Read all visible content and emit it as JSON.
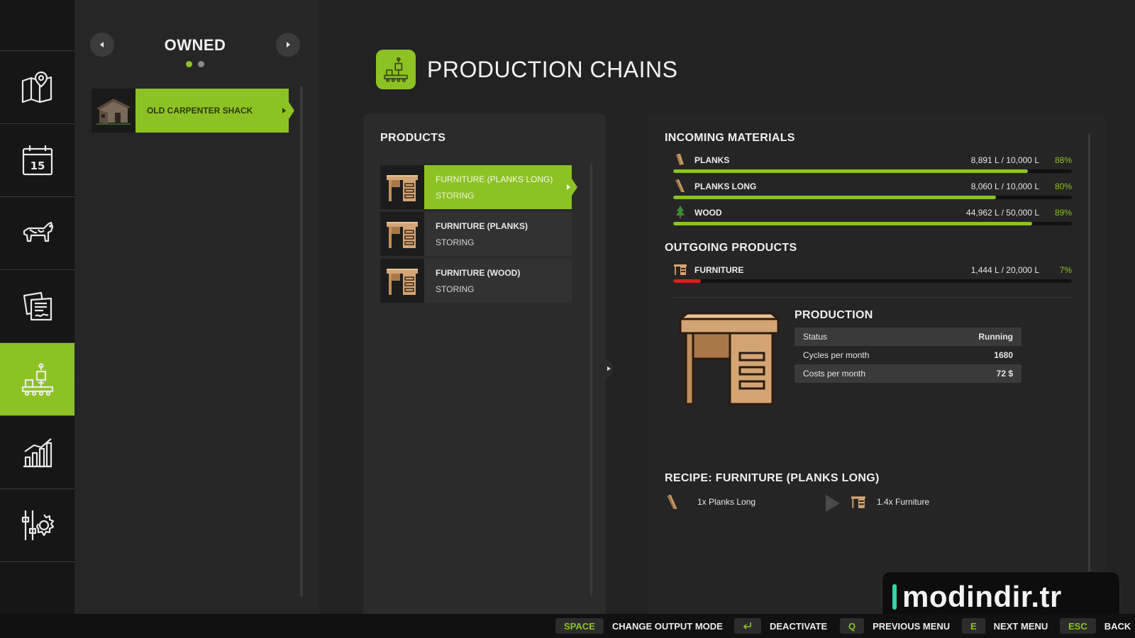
{
  "owned": {
    "title": "OWNED",
    "page_dots": 2,
    "active_dot": 1,
    "items": [
      {
        "label": "OLD CARPENTER SHACK",
        "icon": "shack-thumbnail",
        "selected": true
      }
    ]
  },
  "nav": {
    "items": [
      {
        "name": "map",
        "icon": "map-icon"
      },
      {
        "name": "calendar",
        "icon": "calendar-icon",
        "day": "15"
      },
      {
        "name": "animals",
        "icon": "cow-icon"
      },
      {
        "name": "contracts",
        "icon": "contracts-icon"
      },
      {
        "name": "production",
        "icon": "production-icon",
        "active": true
      },
      {
        "name": "statistics",
        "icon": "chart-icon"
      },
      {
        "name": "settings",
        "icon": "settings-icon"
      }
    ]
  },
  "header": {
    "title": "PRODUCTION CHAINS",
    "icon": "production-icon"
  },
  "products": {
    "title": "PRODUCTS",
    "items": [
      {
        "name": "FURNITURE (PLANKS LONG)",
        "state": "STORING",
        "selected": true
      },
      {
        "name": "FURNITURE (PLANKS)",
        "state": "STORING",
        "selected": false
      },
      {
        "name": "FURNITURE (WOOD)",
        "state": "STORING",
        "selected": false
      }
    ]
  },
  "incoming": {
    "title": "INCOMING MATERIALS",
    "items": [
      {
        "name": "PLANKS",
        "amount": "8,891 L / 10,000 L",
        "percent": "88%",
        "fill": 0.89,
        "icon": "planks-icon"
      },
      {
        "name": "PLANKS LONG",
        "amount": "8,060 L / 10,000 L",
        "percent": "80%",
        "fill": 0.81,
        "icon": "planks-long-icon"
      },
      {
        "name": "WOOD",
        "amount": "44,962 L / 50,000 L",
        "percent": "89%",
        "fill": 0.9,
        "icon": "tree-icon"
      }
    ]
  },
  "outgoing": {
    "title": "OUTGOING PRODUCTS",
    "items": [
      {
        "name": "FURNITURE",
        "amount": "1,444 L / 20,000 L",
        "percent": "7%",
        "fill": 0.07,
        "icon": "furniture-icon"
      }
    ]
  },
  "production": {
    "title": "PRODUCTION",
    "rows": [
      {
        "label": "Status",
        "value": "Running"
      },
      {
        "label": "Cycles per month",
        "value": "1680"
      },
      {
        "label": "Costs per month",
        "value": "72 $"
      }
    ]
  },
  "recipe": {
    "title": "RECIPE: FURNITURE (PLANKS LONG)",
    "input": "1x Planks Long",
    "output": "1.4x Furniture"
  },
  "footer": {
    "hints": [
      {
        "key": "SPACE",
        "label": "CHANGE OUTPUT MODE"
      },
      {
        "key": "",
        "key_icon": "enter-icon",
        "label": "DEACTIVATE"
      },
      {
        "key": "Q",
        "label": "PREVIOUS MENU"
      },
      {
        "key": "E",
        "label": "NEXT MENU"
      },
      {
        "key": "ESC",
        "label": "BACK"
      }
    ]
  },
  "watermark": {
    "text": "modindir.tr"
  },
  "colors": {
    "accent": "#8dc224",
    "low_fill": "#d81f1f",
    "panel": "#2b2b2b",
    "background": "#222222"
  }
}
